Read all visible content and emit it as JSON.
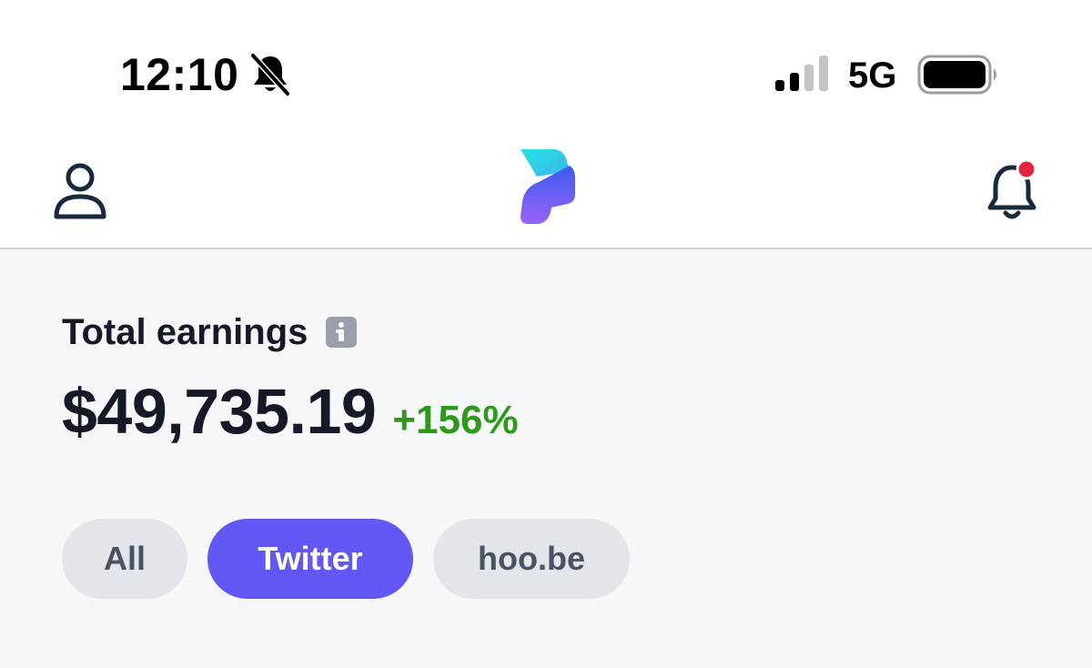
{
  "status_bar": {
    "time": "12:10",
    "network": "5G",
    "icons": [
      "bell-slash-icon",
      "signal-icon",
      "battery-icon"
    ]
  },
  "header": {
    "icons": [
      "profile-icon",
      "app-logo",
      "bell-icon"
    ],
    "notification_badge_color": "#e0273f"
  },
  "earnings": {
    "label": "Total earnings",
    "amount": "$49,735.19",
    "change": "+156%",
    "change_color": "#2f9a1a"
  },
  "filters": {
    "items": [
      {
        "label": "All",
        "selected": false
      },
      {
        "label": "Twitter",
        "selected": true
      },
      {
        "label": "hoo.be",
        "selected": false
      }
    ],
    "accent_color": "#6257f5"
  }
}
